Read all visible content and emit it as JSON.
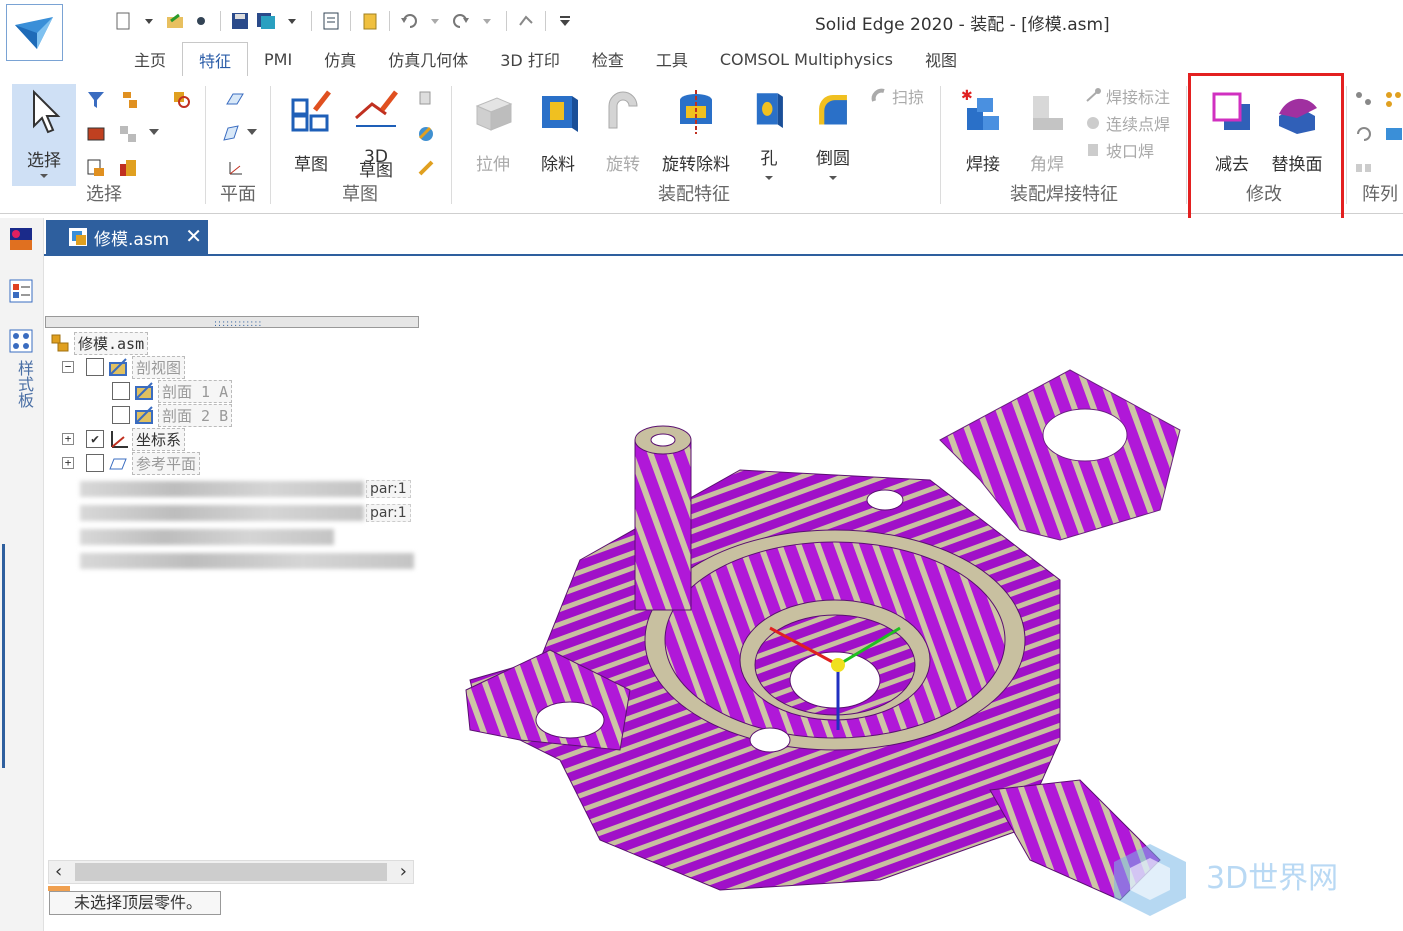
{
  "app": {
    "title": "Solid Edge 2020 - 装配 - [修模.asm]"
  },
  "tabs": [
    "主页",
    "特征",
    "PMI",
    "仿真",
    "仿真几何体",
    "3D 打印",
    "检查",
    "工具",
    "COMSOL Multiphysics",
    "视图"
  ],
  "ribbon": {
    "select": {
      "label": "选择",
      "group": "选择"
    },
    "plane_group": "平面",
    "sketch": {
      "sketch_label": "草图",
      "sketch3d_label_a": "3D",
      "sketch3d_label_b": "草图",
      "group": "草图"
    },
    "assembly_features": {
      "extrude": "拉伸",
      "cutout": "除料",
      "revolve": "旋转",
      "revolved_cutout": "旋转除料",
      "hole": "孔",
      "round": "倒圆",
      "sweep": "扫掠",
      "group": "装配特征"
    },
    "weld": {
      "weld": "焊接",
      "fillet_weld": "角焊",
      "weld_label": "焊接标注",
      "stitch_weld": "连续点焊",
      "groove_weld": "坡口焊",
      "group": "装配焊接特征"
    },
    "modify": {
      "subtract": "减去",
      "replace_face": "替换面",
      "group": "修改"
    },
    "pattern_group": "阵列"
  },
  "document_tab": {
    "name": "修模.asm"
  },
  "sidebar": {
    "style_panel": "样式板"
  },
  "tree": {
    "root": "修模.asm",
    "section_views": "剖视图",
    "section_a": "剖面 1 A",
    "section_b": "剖面 2 B",
    "coord_sys": "坐标系",
    "ref_planes": "参考平面",
    "part1_suffix": "par:1",
    "part2_suffix": "par:1"
  },
  "status": "未选择顶层零件。",
  "watermark": "3D世界网",
  "colors": {
    "accent": "#2e5f9e",
    "highlight": "#e32020",
    "model_purple": "#a010c8",
    "model_tan": "#c8c0a0"
  }
}
